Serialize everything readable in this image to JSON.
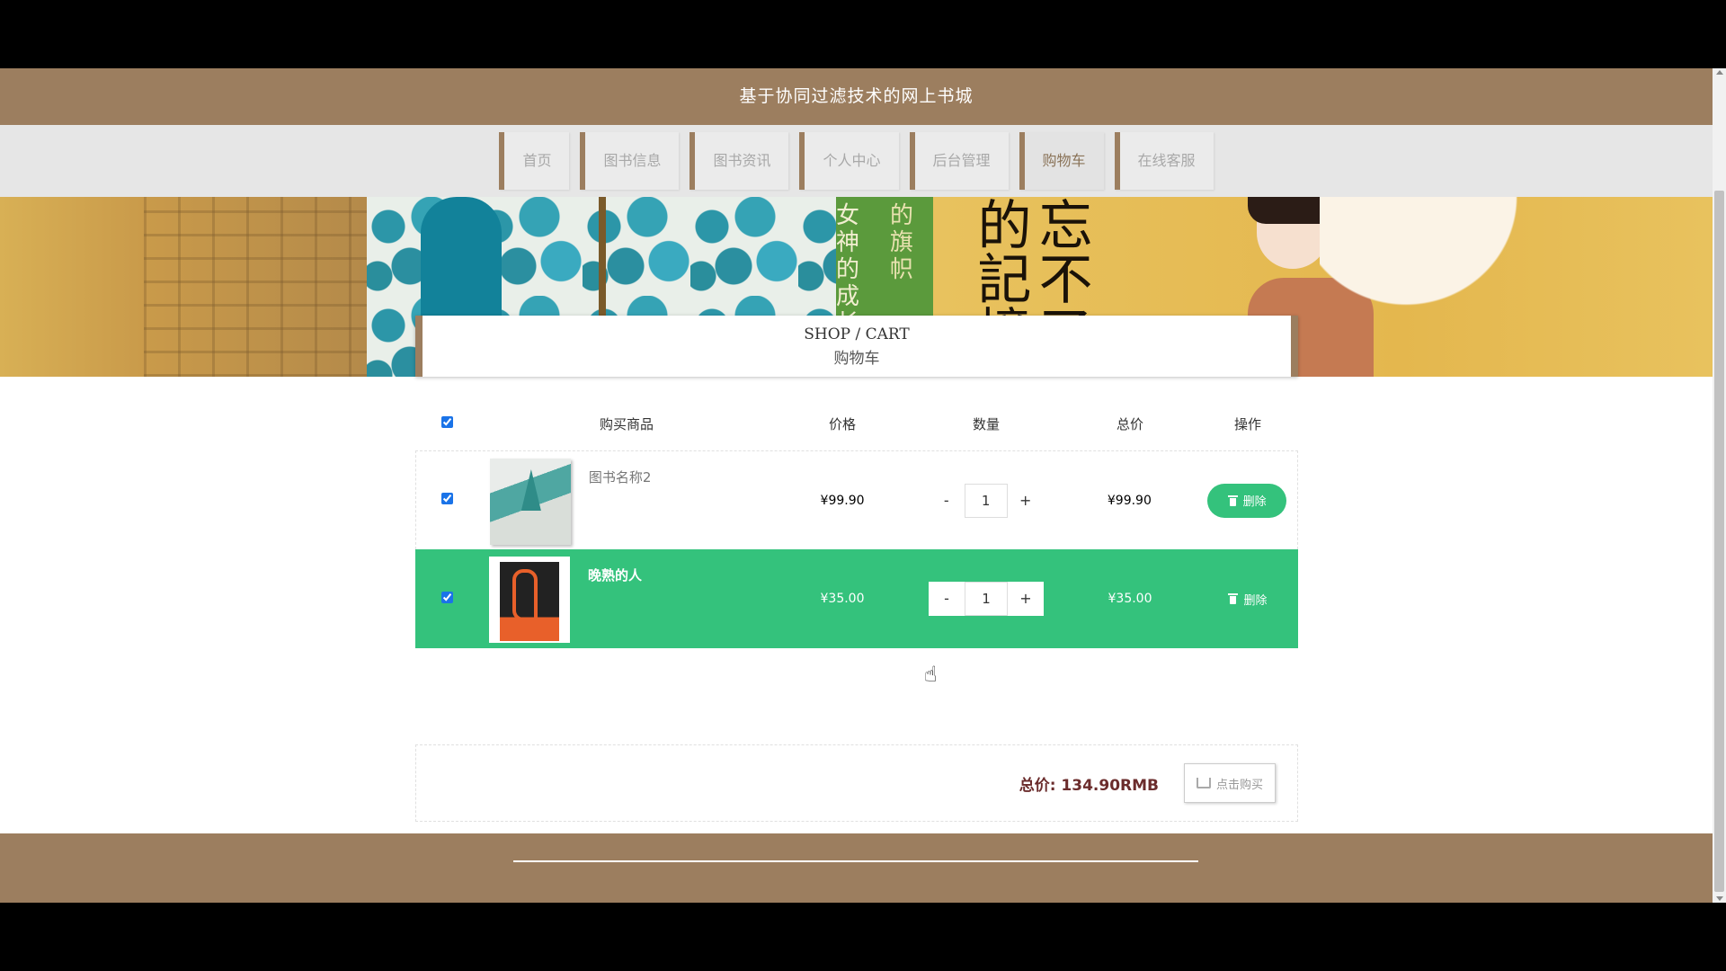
{
  "header": {
    "title": "基于协同过滤技术的网上书城"
  },
  "nav": {
    "items": [
      {
        "label": "首页"
      },
      {
        "label": "图书信息"
      },
      {
        "label": "图书资讯"
      },
      {
        "label": "个人中心"
      },
      {
        "label": "后台管理"
      },
      {
        "label": "购物车"
      },
      {
        "label": "在线客服"
      }
    ],
    "active": "购物车"
  },
  "banner": {
    "book_spine_text": [
      "女神的成长足迹",
      "的旗帜"
    ],
    "book_title_text": "忘不了的記憶",
    "slides": 2
  },
  "breadcrumb": {
    "en": "SHOP / CART",
    "zh": "购物车"
  },
  "table": {
    "headers": {
      "goods": "购买商品",
      "price": "价格",
      "qty": "数量",
      "total": "总价",
      "op": "操作"
    },
    "rows": [
      {
        "name": "图书名称2",
        "price": "¥99.90",
        "qty": "1",
        "total": "¥99.90",
        "delete": "删除",
        "checked": true,
        "highlighted": false
      },
      {
        "name": "晚熟的人",
        "price": "¥35.00",
        "qty": "1",
        "total": "¥35.00",
        "delete": "删除",
        "checked": true,
        "highlighted": true
      }
    ],
    "minus": "-",
    "plus": "+"
  },
  "summary": {
    "total_label": "总价: 134.90RMB",
    "buy_label": "点击购买"
  },
  "colors": {
    "brand": "#9c7e5f",
    "accent_green": "#34c27c",
    "total_text": "#6b2c2c"
  }
}
